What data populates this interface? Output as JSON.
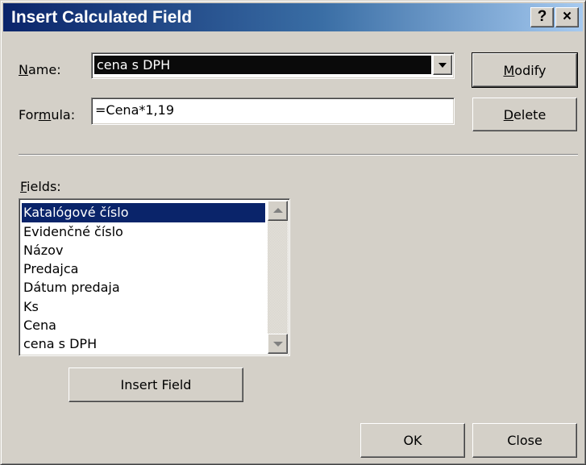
{
  "window": {
    "title": "Insert Calculated Field",
    "help_label": "?",
    "close_label": "×"
  },
  "name_field": {
    "label_mnemonic": "N",
    "label_rest": "ame:",
    "value": "cena s DPH"
  },
  "formula_field": {
    "label_pre": "For",
    "label_mnemonic": "m",
    "label_post": "ula:",
    "value": "=Cena*1,19"
  },
  "buttons": {
    "modify_mnemonic": "M",
    "modify_rest": "odify",
    "delete_mnemonic": "D",
    "delete_rest": "elete",
    "insert_field": "Insert Field",
    "ok": "OK",
    "close": "Close"
  },
  "fields_list": {
    "label_mnemonic": "F",
    "label_rest": "ields:",
    "items": [
      "Katalógové číslo",
      "Evidenčné číslo",
      "Názov",
      "Predajca",
      "Dátum predaja",
      "Ks",
      "Cena",
      "cena s DPH"
    ],
    "selected": "Katalógové číslo"
  },
  "colors": {
    "title_gradient_start": "#0a246a",
    "title_gradient_end": "#a6caf0",
    "face": "#d4d0c8",
    "selection": "#0a246a"
  }
}
